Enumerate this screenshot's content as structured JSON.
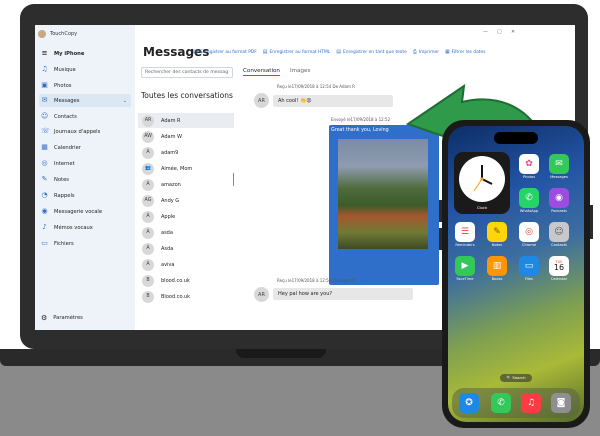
{
  "window": {
    "app_name": "TouchCopy",
    "controls": [
      "—",
      "▢",
      "✕"
    ]
  },
  "sidebar": {
    "header": "My iPhone",
    "items": [
      {
        "label": "Musique",
        "icon": "♫"
      },
      {
        "label": "Photos",
        "icon": "▣"
      },
      {
        "label": "Messages",
        "icon": "✉"
      },
      {
        "label": "Contacts",
        "icon": "☺"
      },
      {
        "label": "Journaux d'appels",
        "icon": "☏"
      },
      {
        "label": "Calendrier",
        "icon": "▦"
      },
      {
        "label": "Internet",
        "icon": "◎"
      },
      {
        "label": "Notes",
        "icon": "✎"
      },
      {
        "label": "Rappels",
        "icon": "◔"
      },
      {
        "label": "Messagerie vocale",
        "icon": "◉"
      },
      {
        "label": "Mémos vocaux",
        "icon": "♪"
      },
      {
        "label": "Fichiers",
        "icon": "▭"
      }
    ],
    "settings": "Paramètres"
  },
  "main": {
    "title": "Messages",
    "toolbar": [
      {
        "label": "Enregistrer au format PDF",
        "icon": "▤"
      },
      {
        "label": "Enregistrer au format HTML",
        "icon": "▤"
      },
      {
        "label": "Enregistrer en tant que texte",
        "icon": "▤"
      },
      {
        "label": "Imprimer",
        "icon": "⎙"
      },
      {
        "label": "Filtrer les dates",
        "icon": "▦"
      }
    ],
    "search_placeholder": "Rechercher des contacts de messag",
    "tabs": [
      "Conversation",
      "Images"
    ],
    "conversations_header": "Toutes les conversations",
    "contacts": [
      {
        "initials": "AR",
        "name": "Adam R"
      },
      {
        "initials": "AW",
        "name": "Adam W"
      },
      {
        "initials": "A",
        "name": "adam9"
      },
      {
        "initials": "👥",
        "name": "Aimée, Mom"
      },
      {
        "initials": "A",
        "name": "amazon"
      },
      {
        "initials": "AG",
        "name": "Andy G"
      },
      {
        "initials": "A",
        "name": "Apple"
      },
      {
        "initials": "A",
        "name": "asda"
      },
      {
        "initials": "A",
        "name": "Asda"
      },
      {
        "initials": "A",
        "name": "aviva"
      },
      {
        "initials": "B",
        "name": "blood.co.uk"
      },
      {
        "initials": "B",
        "name": "Blood.co.uk"
      }
    ],
    "messages": [
      {
        "meta": "Reçu le17/09/2018 à 12:54 De Adam R",
        "avatar": "AR",
        "text": "Ah cool! 👏😮"
      },
      {
        "meta": "Envoyé le17/09/2018 à 12:52",
        "text": "Great thank you, Loving"
      },
      {
        "meta": "Reçu le17/09/2018 à 12:50 De Adam R",
        "avatar": "AR",
        "text": "Hey pal how are you?"
      }
    ]
  },
  "phone": {
    "widget_label": "Clock",
    "apps": [
      {
        "label": "Photos",
        "icon": "✿",
        "color": "#ffffff"
      },
      {
        "label": "Messages",
        "icon": "✉",
        "color": "#34c759"
      },
      {
        "label": "WhatsApp",
        "icon": "✆",
        "color": "#25d366"
      },
      {
        "label": "Podcasts",
        "icon": "◉",
        "color": "#9b4de0"
      },
      {
        "label": "Reminders",
        "icon": "☰",
        "color": "#ffffff"
      },
      {
        "label": "Notes",
        "icon": "✎",
        "color": "#ffd60a"
      },
      {
        "label": "Chrome",
        "icon": "◎",
        "color": "#ffffff"
      },
      {
        "label": "Contacts",
        "icon": "☺",
        "color": "#c7c7cc"
      },
      {
        "label": "FaceTime",
        "icon": "▶",
        "color": "#34c759"
      },
      {
        "label": "Books",
        "icon": "▥",
        "color": "#ff9500"
      },
      {
        "label": "Files",
        "icon": "▭",
        "color": "#1e88e5"
      },
      {
        "label": "Calendar",
        "icon": "16",
        "color": "#ffffff"
      }
    ],
    "calendar_day": "TUE",
    "search": "🔍 Search",
    "dock": [
      {
        "icon": "✪",
        "color": "#1e88e5"
      },
      {
        "icon": "✆",
        "color": "#34c759"
      },
      {
        "icon": "♫",
        "color": "#fc3c44"
      },
      {
        "icon": "◙",
        "color": "#8e8e93"
      }
    ]
  }
}
